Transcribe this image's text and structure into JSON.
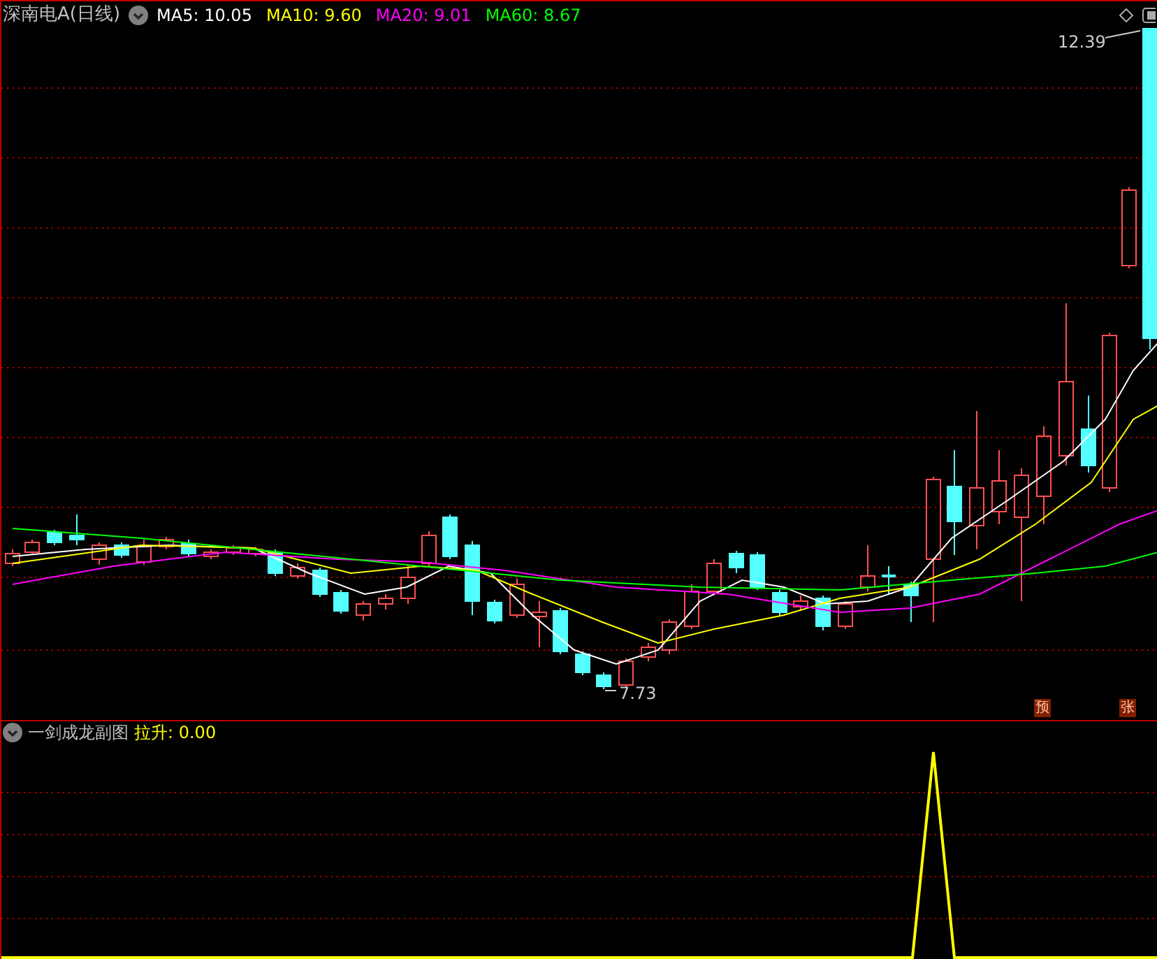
{
  "header": {
    "title": "深南电A(日线)",
    "moving_averages": [
      {
        "label": "MA5: 10.05",
        "color": "#ffffff"
      },
      {
        "label": "MA10: 9.60",
        "color": "#ffff00"
      },
      {
        "label": "MA20: 9.01",
        "color": "#ff00ff"
      },
      {
        "label": "MA60: 8.67",
        "color": "#00ff00"
      }
    ]
  },
  "main_chart": {
    "high_label": "12.39",
    "low_label": "7.73",
    "markers": [
      "预",
      "张"
    ]
  },
  "sub_panel": {
    "title": "一剑成龙副图",
    "indicator": "拉升: 0.00"
  }
}
